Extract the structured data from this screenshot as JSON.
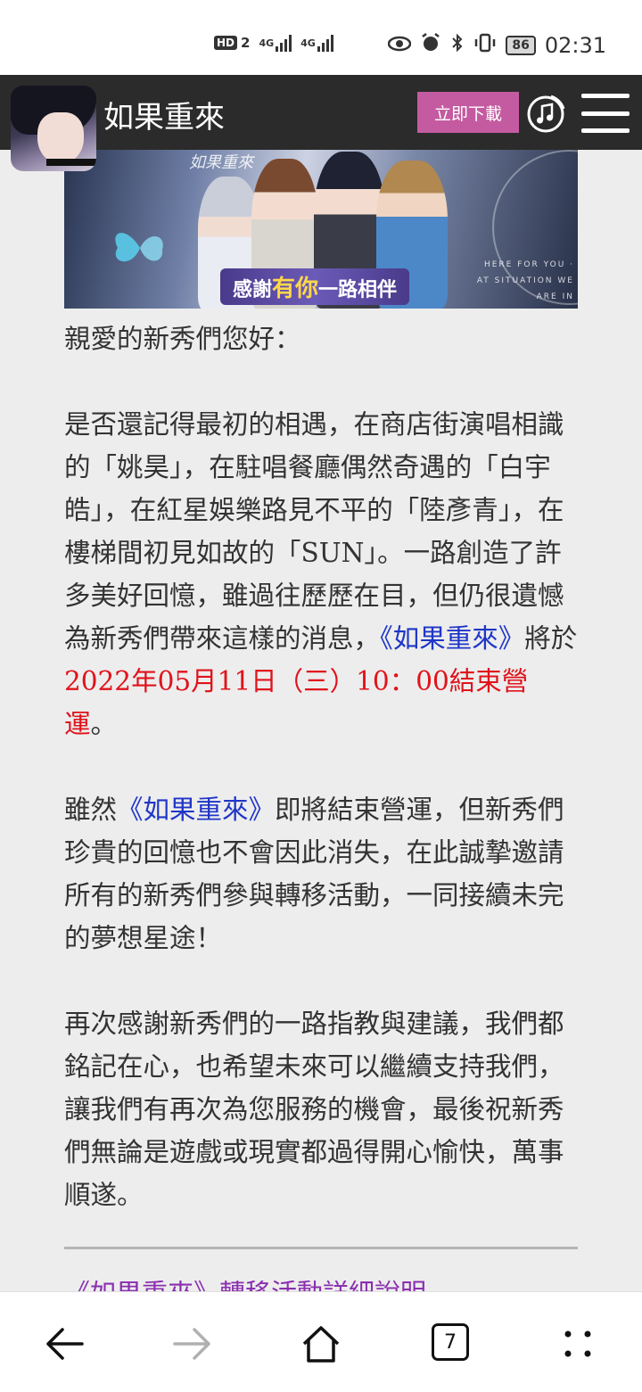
{
  "status_bar": {
    "hd_label": "HD",
    "sim_number": "2",
    "network_1": "4G",
    "network_2": "4G",
    "battery": "86",
    "time": "02:31"
  },
  "header": {
    "app_title": "如果重來",
    "download_label": "立即下載",
    "icons": [
      "app-icon",
      "music-icon",
      "menu-icon"
    ]
  },
  "banner": {
    "logo_text": "如果重來",
    "slogan_part1": "感謝",
    "slogan_part2": "有你",
    "slogan_part3": "一路相伴",
    "side_text": "HERE FOR YOU · AT SITUATION WE ARE IN"
  },
  "article": {
    "greeting": "親愛的新秀們您好：",
    "p1_text": "是否還記得最初的相遇，在商店街演唱相識的「姚昊」，在駐唱餐廳偶然奇遇的「白宇皓」，在紅星娛樂路見不平的「陸彥青」，在樓梯間初見如故的「SUN」。一路創造了許多美好回憶，雖過往歷歷在目，但仍很遺憾為新秀們帶來這樣的消息，",
    "p1_game": "《如果重來》",
    "p1_mid": "將於",
    "p1_date": "2022年05月11日（三）10：00結束營運",
    "p1_end": "。",
    "p2_start": "雖然",
    "p2_game": "《如果重來》",
    "p2_text": "即將結束營運，但新秀們珍貴的回憶也不會因此消失，在此誠摯邀請所有的新秀們參與轉移活動，一同接續未完的夢想星途！",
    "p3_text": "再次感謝新秀們的一路指教與建議，我們都銘記在心，也希望未來可以繼續支持我們，讓我們有再次為您服務的機會，最後祝新秀們無論是遊戲或現實都過得開心愉快，萬事順遂。",
    "cut_link": "《如果重來》轉移活動詳細說明"
  },
  "nav_bar": {
    "tab_count": "7",
    "icons": [
      "back-arrow-icon",
      "forward-arrow-icon",
      "home-icon",
      "tabs-icon",
      "more-icon"
    ]
  },
  "colors": {
    "accent_pink": "#c45ba0",
    "header_bg": "#2b2b2b",
    "link_blue": "#1f36c7",
    "highlight_red": "#e0131b"
  }
}
